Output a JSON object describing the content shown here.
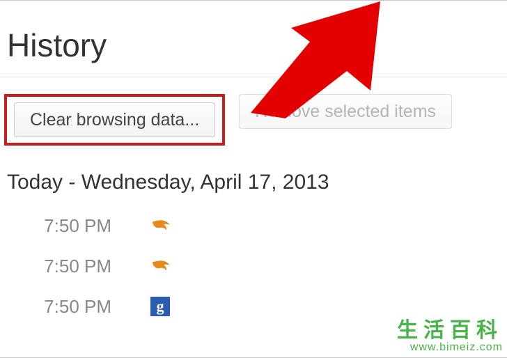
{
  "header": {
    "title": "History"
  },
  "toolbar": {
    "clear_label": "Clear browsing data...",
    "remove_label": "Remove selected items"
  },
  "section": {
    "heading": "Today - Wednesday, April 17, 2013"
  },
  "history": {
    "items": [
      {
        "time": "7:50 PM",
        "favicon": "amazon-icon"
      },
      {
        "time": "7:50 PM",
        "favicon": "amazon-icon"
      },
      {
        "time": "7:50 PM",
        "favicon": "google-icon"
      }
    ]
  },
  "watermark": {
    "line1": "生活百科",
    "line2": "www.bimeiz.com"
  },
  "annotation": {
    "arrow_color": "#e20000",
    "highlight_color": "#c41e1e"
  }
}
